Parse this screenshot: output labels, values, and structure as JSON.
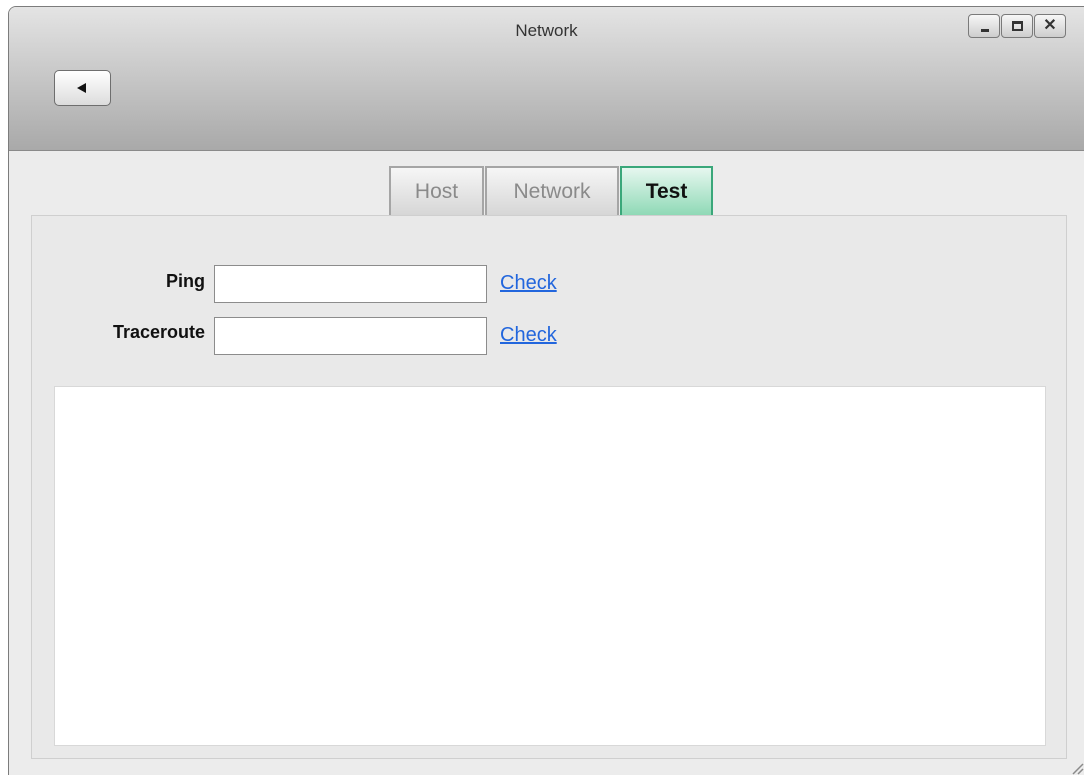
{
  "window": {
    "title": "Network"
  },
  "tabs": [
    {
      "label": "Host",
      "active": false
    },
    {
      "label": "Network",
      "active": false
    },
    {
      "label": "Test",
      "active": true
    }
  ],
  "form": {
    "ping": {
      "label": "Ping",
      "value": "",
      "action_label": "Check"
    },
    "traceroute": {
      "label": "Traceroute",
      "value": "",
      "action_label": "Check"
    }
  },
  "output": {
    "text": ""
  },
  "icons": {
    "back": "back-arrow-icon",
    "minimize": "minimize-icon",
    "maximize": "maximize-icon",
    "close": "close-icon",
    "resize": "resize-grip-icon"
  },
  "colors": {
    "active_tab_border": "#3aa77a",
    "active_tab_fill": "#8fd9b6",
    "link": "#2266dd"
  }
}
